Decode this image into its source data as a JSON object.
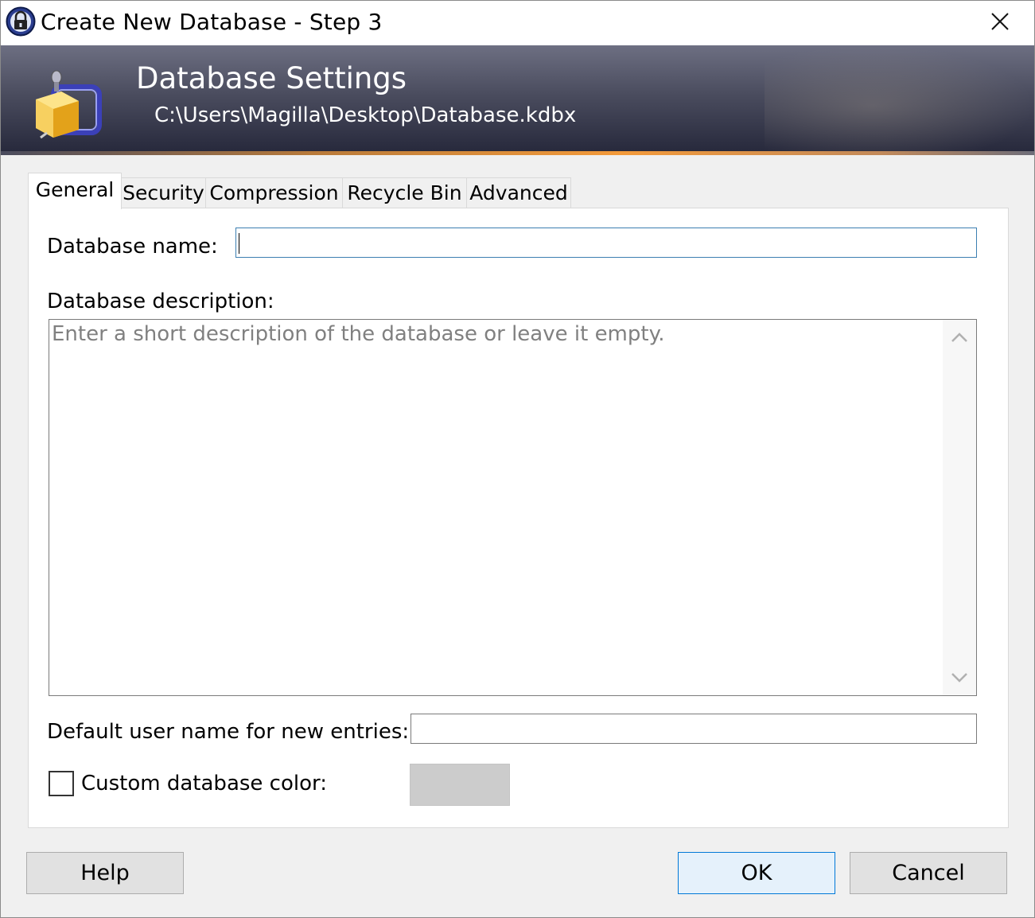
{
  "window": {
    "title": "Create New Database - Step 3",
    "close_glyph": "✕"
  },
  "banner": {
    "title": "Database Settings",
    "path": "C:\\Users\\Magilla\\Desktop\\Database.kdbx",
    "icon": "keepass-database-icon"
  },
  "tabs": [
    {
      "label": "General",
      "active": true
    },
    {
      "label": "Security",
      "active": false
    },
    {
      "label": "Compression",
      "active": false
    },
    {
      "label": "Recycle Bin",
      "active": false
    },
    {
      "label": "Advanced",
      "active": false
    }
  ],
  "general": {
    "name_label": "Database name:",
    "name_value": "",
    "description_label": "Database description:",
    "description_placeholder": "Enter a short description of the database or leave it empty.",
    "default_user_label": "Default user name for new entries:",
    "default_user_value": "",
    "custom_color_label": "Custom database color:",
    "custom_color_checked": false,
    "color_swatch": "#cccccc"
  },
  "buttons": {
    "help": "Help",
    "ok": "OK",
    "cancel": "Cancel"
  },
  "colors": {
    "focus_border": "#3c7fb1",
    "default_button_border": "#0078d7",
    "banner_accent": "#f39a3a"
  }
}
